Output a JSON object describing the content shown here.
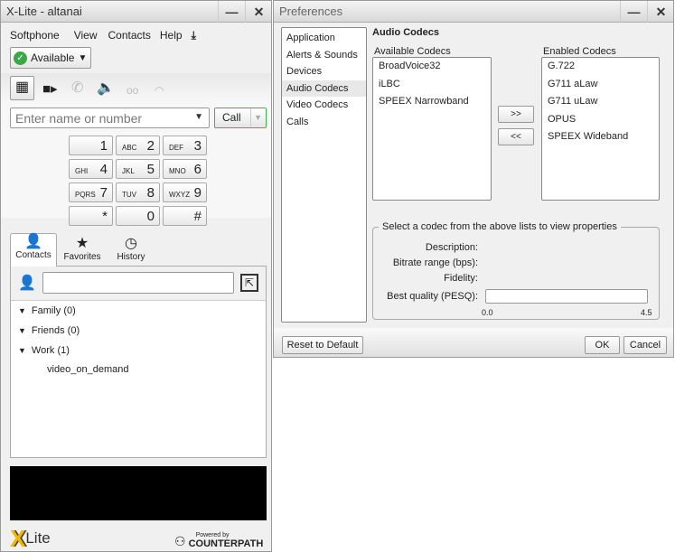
{
  "softphone": {
    "title": "X-Lite - altanai",
    "menu": [
      "Softphone",
      "View",
      "Contacts",
      "Help"
    ],
    "status": "Available",
    "dial_placeholder": "Enter name or number",
    "call_label": "Call",
    "keypad": [
      {
        "n": "1",
        "l": ""
      },
      {
        "n": "2",
        "l": "ABC"
      },
      {
        "n": "3",
        "l": "DEF"
      },
      {
        "n": "4",
        "l": "GHI"
      },
      {
        "n": "5",
        "l": "JKL"
      },
      {
        "n": "6",
        "l": "MNO"
      },
      {
        "n": "7",
        "l": "PQRS"
      },
      {
        "n": "8",
        "l": "TUV"
      },
      {
        "n": "9",
        "l": "WXYZ"
      },
      {
        "n": "*",
        "l": ""
      },
      {
        "n": "0",
        "l": ""
      },
      {
        "n": "#",
        "l": ""
      }
    ],
    "tabs": [
      "Contacts",
      "Favorites",
      "History"
    ],
    "groups": [
      "Family (0)",
      "Friends (0)",
      "Work (1)"
    ],
    "contact": "video_on_demand",
    "logo": "Lite",
    "powered_by": "Powered by",
    "brand": "COUNTERPATH"
  },
  "prefs": {
    "title": "Preferences",
    "nav": [
      "Application",
      "Alerts & Sounds",
      "Devices",
      "Audio Codecs",
      "Video Codecs",
      "Calls"
    ],
    "heading": "Audio Codecs",
    "available_label": "Available Codecs",
    "enabled_label": "Enabled Codecs",
    "available": [
      "BroadVoice32",
      "iLBC",
      "SPEEX Narrowband"
    ],
    "enabled": [
      "G.722",
      "G711 aLaw",
      "G711 uLaw",
      "OPUS",
      "SPEEX Wideband"
    ],
    "add": ">>",
    "remove": "<<",
    "group_title": "Select a codec from the above lists to view properties",
    "props": [
      "Description:",
      "Bitrate range (bps):",
      "Fidelity:",
      "Best quality (PESQ):"
    ],
    "scale_min": "0.0",
    "scale_max": "4.5",
    "quality_value": 0,
    "reset": "Reset to Default",
    "ok": "OK",
    "cancel": "Cancel"
  }
}
